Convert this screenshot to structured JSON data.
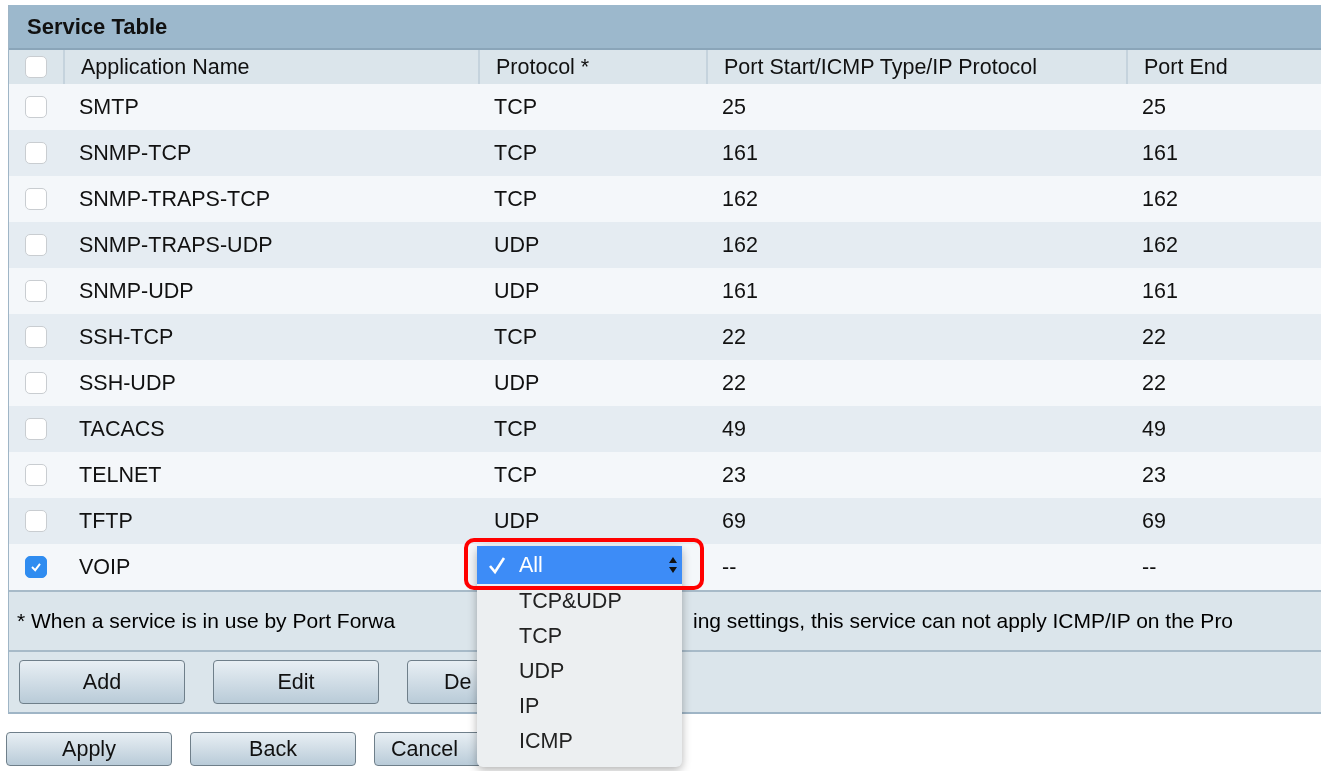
{
  "panel": {
    "title": "Service Table"
  },
  "table": {
    "select_all_checked": false,
    "columns": [
      "Application Name",
      "Protocol *",
      "Port Start/ICMP Type/IP Protocol",
      "Port End"
    ],
    "rows": [
      {
        "checked": false,
        "name": "SMTP",
        "protocol": "TCP",
        "port_start": "25",
        "port_end": "25"
      },
      {
        "checked": false,
        "name": "SNMP-TCP",
        "protocol": "TCP",
        "port_start": "161",
        "port_end": "161"
      },
      {
        "checked": false,
        "name": "SNMP-TRAPS-TCP",
        "protocol": "TCP",
        "port_start": "162",
        "port_end": "162"
      },
      {
        "checked": false,
        "name": "SNMP-TRAPS-UDP",
        "protocol": "UDP",
        "port_start": "162",
        "port_end": "162"
      },
      {
        "checked": false,
        "name": "SNMP-UDP",
        "protocol": "UDP",
        "port_start": "161",
        "port_end": "161"
      },
      {
        "checked": false,
        "name": "SSH-TCP",
        "protocol": "TCP",
        "port_start": "22",
        "port_end": "22"
      },
      {
        "checked": false,
        "name": "SSH-UDP",
        "protocol": "UDP",
        "port_start": "22",
        "port_end": "22"
      },
      {
        "checked": false,
        "name": "TACACS",
        "protocol": "TCP",
        "port_start": "49",
        "port_end": "49"
      },
      {
        "checked": false,
        "name": "TELNET",
        "protocol": "TCP",
        "port_start": "23",
        "port_end": "23"
      },
      {
        "checked": false,
        "name": "TFTP",
        "protocol": "UDP",
        "port_start": "69",
        "port_end": "69"
      },
      {
        "checked": true,
        "name": "VOIP",
        "port_start": "--",
        "port_end": "--"
      }
    ]
  },
  "protocol_dropdown": {
    "options": [
      {
        "label": "All",
        "selected": true
      },
      {
        "label": "TCP&UDP",
        "selected": false
      },
      {
        "label": "TCP",
        "selected": false
      },
      {
        "label": "UDP",
        "selected": false
      },
      {
        "label": "IP",
        "selected": false
      },
      {
        "label": "ICMP",
        "selected": false
      }
    ]
  },
  "note": {
    "left": "* When a service is in use by Port Forwa",
    "right": "ing settings, this service can not apply ICMP/IP on the Pro"
  },
  "table_buttons": [
    "Add",
    "Edit",
    "De"
  ],
  "page_buttons": [
    "Apply",
    "Back",
    "Cancel"
  ]
}
